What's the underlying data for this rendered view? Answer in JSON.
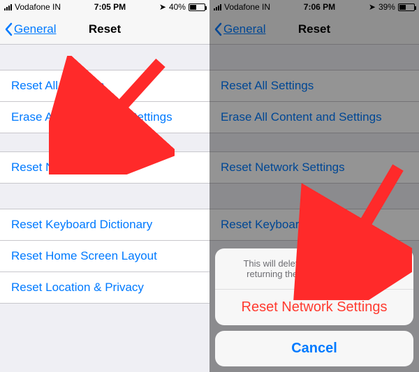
{
  "left": {
    "status": {
      "carrier": "Vodafone IN",
      "time": "7:05 PM",
      "battery_pct": "40%",
      "battery_fill": 40
    },
    "nav": {
      "back": "General",
      "title": "Reset"
    },
    "rows": {
      "r1": "Reset All Settings",
      "r2": "Erase All Content and Settings",
      "r3": "Reset Network Settings",
      "r4": "Reset Keyboard Dictionary",
      "r5": "Reset Home Screen Layout",
      "r6": "Reset Location & Privacy"
    }
  },
  "right": {
    "status": {
      "carrier": "Vodafone IN",
      "time": "7:06 PM",
      "battery_pct": "39%",
      "battery_fill": 39
    },
    "nav": {
      "back": "General",
      "title": "Reset"
    },
    "rows": {
      "r1": "Reset All Settings",
      "r2": "Erase All Content and Settings",
      "r3": "Reset Network Settings",
      "r4": "Reset Keyboard Dictionary"
    },
    "sheet": {
      "message": "This will delete all network settings, returning them to factory defaults.",
      "action": "Reset Network Settings",
      "cancel": "Cancel"
    }
  },
  "colors": {
    "link": "#007aff",
    "destructive": "#ff3b30"
  }
}
